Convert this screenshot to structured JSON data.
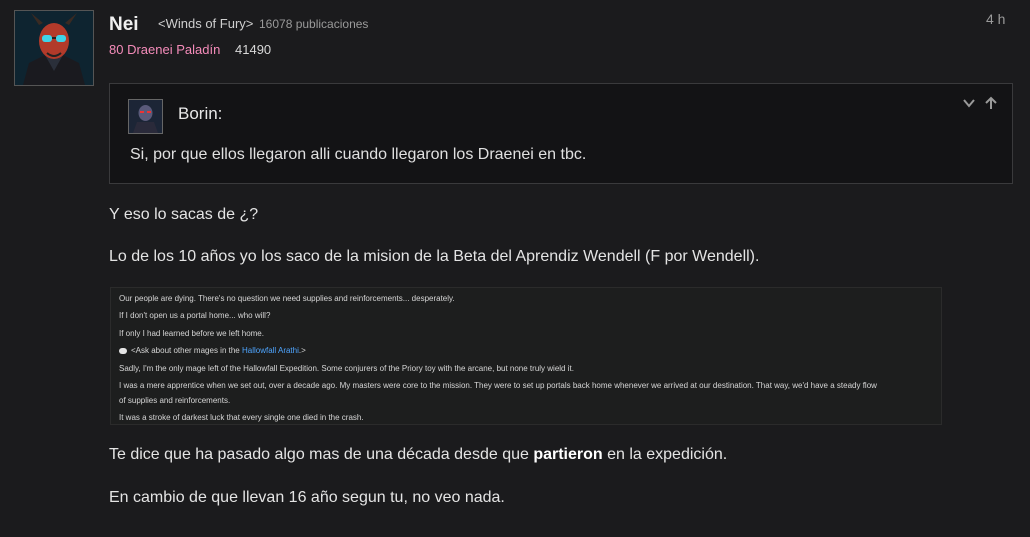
{
  "post": {
    "author": "Nei",
    "guild": "<Winds of Fury>",
    "post_count": "16078 publicaciones",
    "character": "80 Draenei Paladín",
    "achievement_points": "41490",
    "time": "4 h"
  },
  "quote": {
    "author": "Borin:",
    "text": "Si, por que ellos llegaron alli cuando llegaron los Draenei en tbc."
  },
  "body": {
    "p1": "Y eso lo sacas de ¿?",
    "p2": "Lo de los 10 años yo los saco de la mision de la Beta del Aprendiz Wendell (F por Wendell).",
    "p3_before": "Te dice que ha pasado algo mas de una década desde que ",
    "p3_bold": "partieron",
    "p3_after": " en la expedición.",
    "p4": "En cambio de que llevan 16 año segun tu, no veo nada."
  },
  "embed": {
    "line1": "Our people are dying. There's no question we need supplies and reinforcements... desperately.",
    "line2": "If I don't open us a portal home... who will?",
    "line3": "If only I had learned before we left home.",
    "line4_prefix": "<Ask about other mages in the ",
    "line4_link": "Hallowfall Arathi",
    "line4_suffix": ".>",
    "line5": "Sadly, I'm the only mage left of the Hallowfall Expedition. Some conjurers of the Priory toy with the arcane, but none truly wield it.",
    "line6a": "I was a mere apprentice when we set out, over a decade ago. My masters were core to the mission. They were to set up portals back home whenever we arrived at our destination. That way, we'd have a steady flow",
    "line6b": "of supplies and reinforcements.",
    "line7": "It was a stroke of darkest luck that every single one died in the crash."
  }
}
